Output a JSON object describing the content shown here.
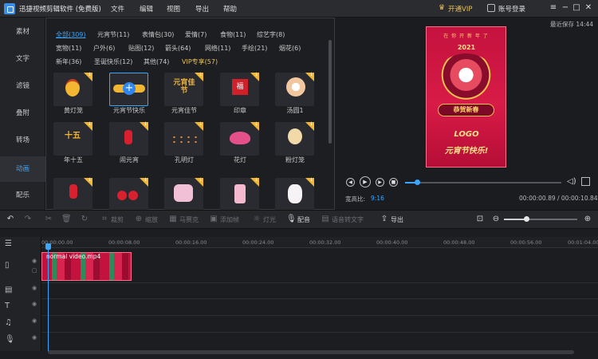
{
  "app": {
    "title": "迅捷视频剪辑软件 (免费版)",
    "vip": "开通VIP",
    "login": "账号登录",
    "autosave": "最近保存 14:44"
  },
  "menu": [
    "文件",
    "编辑",
    "视图",
    "导出",
    "帮助"
  ],
  "nav": [
    "素材",
    "文字",
    "滤镜",
    "叠附",
    "转场",
    "动画",
    "配乐"
  ],
  "nav_active": "动画",
  "categories": [
    "全部(309)",
    "元宵节(11)",
    "表情包(30)",
    "爱情(7)",
    "食物(11)",
    "综艺字(8)",
    "宽物(11)",
    "户外(6)",
    "贴图(12)",
    "箭头(64)",
    "网络(11)",
    "手绘(21)",
    "烟花(6)",
    "新年(36)",
    "圣诞快乐(12)",
    "其他(74)",
    "VIP专享(57)"
  ],
  "tiles": [
    "黄灯笼",
    "元宵节快乐",
    "元宵佳节",
    "印章",
    "汤圆1",
    "年十五",
    "闹元宵",
    "孔明灯",
    "花灯",
    "粉灯笼",
    "",
    "",
    "",
    "",
    ""
  ],
  "tile_text": {
    "t2": "元宵佳节",
    "t3": "福"
  },
  "preview": {
    "poster_top": "在 你 开 新 年 了",
    "poster_year": "2021",
    "poster_bless": "恭贺新春",
    "poster_logo": "LOGO",
    "poster_name": "元宵节快乐!",
    "ratio_label": "宽高比:",
    "ratio_value": "9:16",
    "time": "00:00:00.89 / 00:00:10.84",
    "progress_percent": 8
  },
  "toolbar": {
    "undo": "↶",
    "redo": "↷",
    "crop": "裁剪",
    "zoom": "缩放",
    "mosaic": "马赛克",
    "freeze": "添加帧",
    "spotlight": "灯光",
    "dub": "配音",
    "tts": "语音转文字",
    "export": "导出"
  },
  "ruler": [
    "00:00:00.00",
    "00:00:08.00",
    "00:00:16.00",
    "00:00:24.00",
    "00:00:32.00",
    "00:00:40.00",
    "00:00:48.00",
    "00:00:56.00",
    "00:01:04.00"
  ],
  "clip_label": "normal video.mp4",
  "zoom_level_percent": 30
}
